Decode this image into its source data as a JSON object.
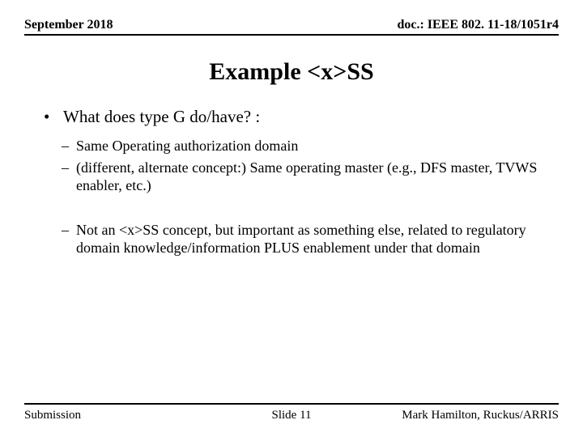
{
  "header": {
    "date": "September 2018",
    "doc": "doc.: IEEE 802. 11-18/1051r4"
  },
  "title": "Example <x>SS",
  "bullets": {
    "item1": "What does type G do/have? :",
    "sub1": "Same Operating authorization domain",
    "sub2": "(different, alternate concept:) Same operating master (e.g., DFS master, TVWS enabler, etc.)",
    "sub3": "Not an <x>SS concept, but important as something else, related to regulatory domain knowledge/information PLUS enablement under that domain"
  },
  "footer": {
    "left": "Submission",
    "center": "Slide 11",
    "right": "Mark Hamilton, Ruckus/ARRIS"
  }
}
